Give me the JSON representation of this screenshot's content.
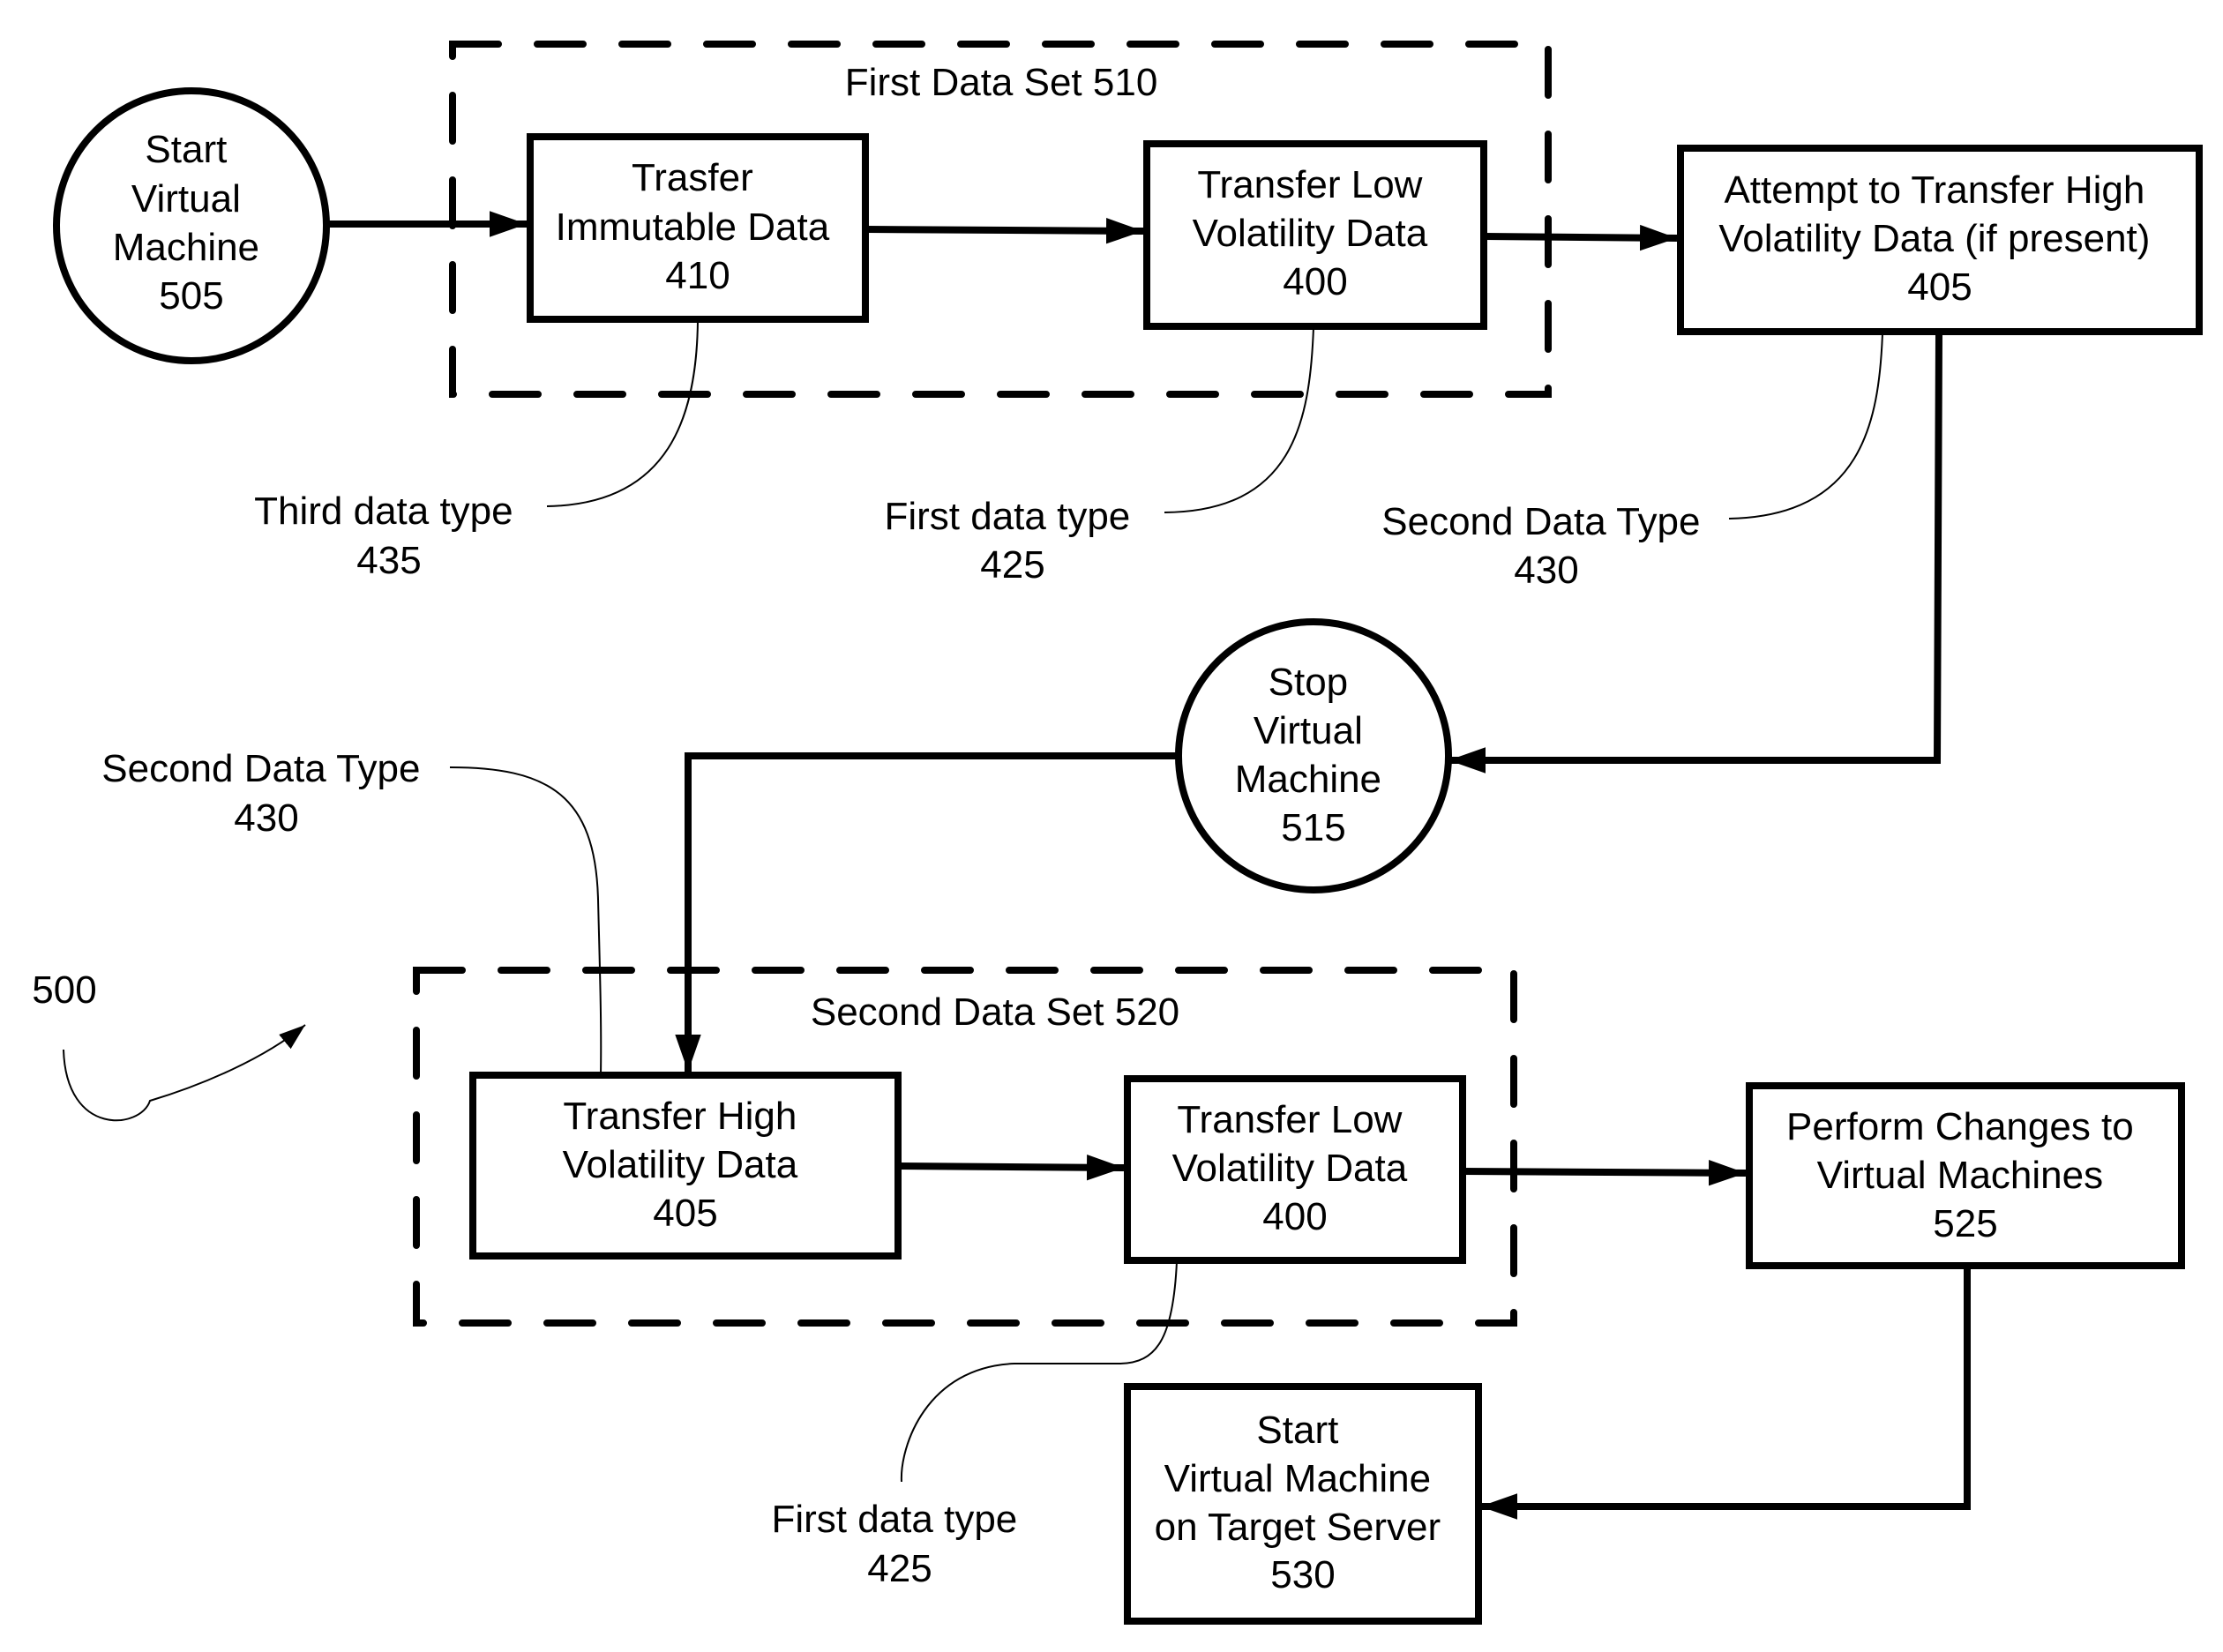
{
  "figure": {
    "reference": "500",
    "groups": [
      {
        "id": "first-data-set",
        "label": "First Data Set 510"
      },
      {
        "id": "second-data-set",
        "label": "Second Data Set 520"
      }
    ],
    "nodes": [
      {
        "id": "n505",
        "shape": "circle",
        "lines": [
          "Start",
          "Virtual",
          "Machine",
          "505"
        ]
      },
      {
        "id": "n410",
        "shape": "box",
        "lines": [
          "Trasfer",
          "Immutable Data",
          "410"
        ]
      },
      {
        "id": "n400a",
        "shape": "box",
        "lines": [
          "Transfer Low",
          "Volatility Data",
          "400"
        ]
      },
      {
        "id": "n405a",
        "shape": "box",
        "lines": [
          "Attempt to Transfer High",
          "Volatility Data (if present)",
          "405"
        ]
      },
      {
        "id": "n515",
        "shape": "circle",
        "lines": [
          "Stop",
          "Virtual",
          "Machine",
          "515"
        ]
      },
      {
        "id": "n405b",
        "shape": "box",
        "lines": [
          "Transfer High",
          "Volatility Data",
          "405"
        ]
      },
      {
        "id": "n400b",
        "shape": "box",
        "lines": [
          "Transfer Low",
          "Volatility Data",
          "400"
        ]
      },
      {
        "id": "n525",
        "shape": "box",
        "lines": [
          "Perform Changes to",
          "Virtual Machines",
          "525"
        ]
      },
      {
        "id": "n530",
        "shape": "box",
        "lines": [
          "Start",
          "Virtual Machine",
          "on Target Server",
          "530"
        ]
      }
    ],
    "callouts": [
      {
        "id": "c435",
        "lines": [
          "Third data type",
          "435"
        ],
        "target": "n410"
      },
      {
        "id": "c425a",
        "lines": [
          "First data type",
          "425"
        ],
        "target": "n400a"
      },
      {
        "id": "c430a",
        "lines": [
          "Second Data Type",
          "430"
        ],
        "target": "n405a"
      },
      {
        "id": "c430b",
        "lines": [
          "Second Data Type",
          "430"
        ],
        "target": "n405b"
      },
      {
        "id": "c425b",
        "lines": [
          "First data type",
          "425"
        ],
        "target": "n400b"
      }
    ],
    "edges": [
      {
        "from": "n505",
        "to": "n410"
      },
      {
        "from": "n410",
        "to": "n400a"
      },
      {
        "from": "n400a",
        "to": "n405a"
      },
      {
        "from": "n405a",
        "to": "n515"
      },
      {
        "from": "n515",
        "to": "n405b"
      },
      {
        "from": "n405b",
        "to": "n400b"
      },
      {
        "from": "n400b",
        "to": "n525"
      },
      {
        "from": "n525",
        "to": "n530"
      }
    ]
  }
}
